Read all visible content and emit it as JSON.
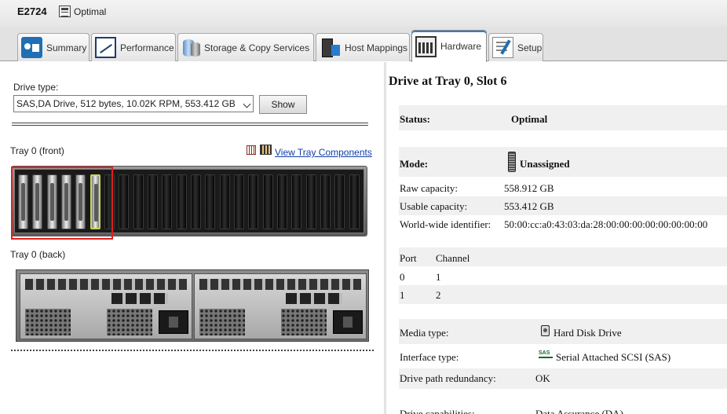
{
  "header": {
    "array_name": "E2724",
    "array_status": "Optimal",
    "status_icon": "storage-array-icon"
  },
  "tabs": [
    {
      "label": "Summary",
      "icon": "summary-icon",
      "active": false
    },
    {
      "label": "Performance",
      "icon": "performance-icon",
      "active": false
    },
    {
      "label": "Storage & Copy Services",
      "icon": "storage-icon",
      "active": false
    },
    {
      "label": "Host Mappings",
      "icon": "host-mappings-icon",
      "active": false
    },
    {
      "label": "Hardware",
      "icon": "hardware-icon",
      "active": true
    },
    {
      "label": "Setup",
      "icon": "setup-icon",
      "active": false
    }
  ],
  "left": {
    "drive_type_label": "Drive type:",
    "drive_type_value": "SAS,DA Drive, 512 bytes, 10.02K RPM, 553.412 GB",
    "show_button": "Show",
    "tray_front_label": "Tray 0 (front)",
    "tray_back_label": "Tray 0 (back)",
    "view_tray_components": "View Tray Components",
    "front_slots_total": 24,
    "populated_slots": 6,
    "selected_slot": 6,
    "selection_color": "#e02020",
    "selected_drive_color": "#c9d85a"
  },
  "right": {
    "title": "Drive at Tray 0, Slot 6",
    "status_label": "Status:",
    "status_value": "Optimal",
    "mode_label": "Mode:",
    "mode_value": "Unassigned",
    "mode_icon": "drive-icon",
    "raw_capacity_label": "Raw capacity:",
    "raw_capacity_value": "558.912 GB",
    "usable_capacity_label": "Usable capacity:",
    "usable_capacity_value": "553.412 GB",
    "wwid_label": "World-wide identifier:",
    "wwid_value": "50:00:cc:a0:43:03:da:28:00:00:00:00:00:00:00:00",
    "port_header": "Port",
    "channel_header": "Channel",
    "ports": [
      {
        "port": "0",
        "channel": "1"
      },
      {
        "port": "1",
        "channel": "2"
      }
    ],
    "media_type_label": "Media type:",
    "media_type_value": "Hard Disk Drive",
    "media_icon": "hard-disk-icon",
    "interface_type_label": "Interface type:",
    "interface_type_value": "Serial Attached SCSI (SAS)",
    "interface_icon_text": "SAS",
    "path_redundancy_label": "Drive path redundancy:",
    "path_redundancy_value": "OK",
    "capabilities_label": "Drive capabilities:",
    "capabilities_value": "Data Assurance (DA)"
  }
}
